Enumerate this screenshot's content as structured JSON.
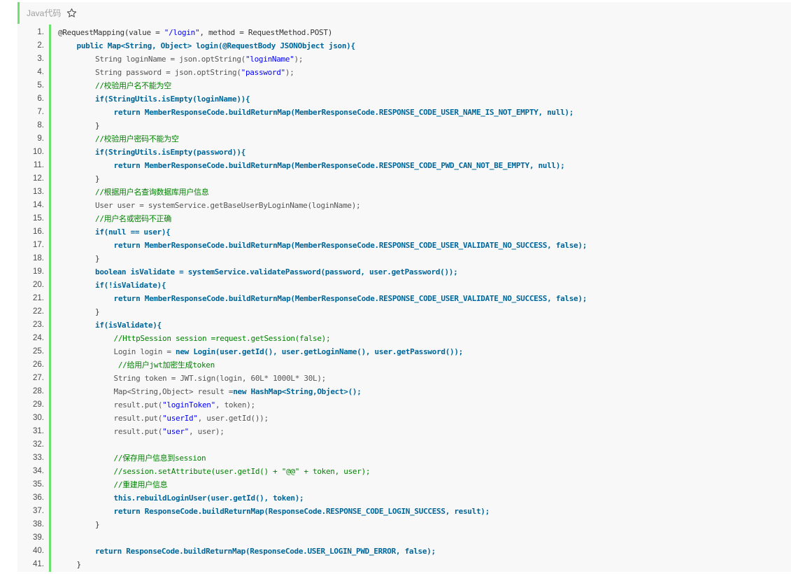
{
  "header": {
    "language_label": "Java代码",
    "favorite_icon": "star-outline-icon"
  },
  "colors": {
    "accent": "#6ce26c",
    "plain": "#333333",
    "keyword": "#006699",
    "string": "#0000ff",
    "comment": "#008200",
    "type": "#555555"
  },
  "lines": [
    {
      "n": "1.",
      "indent": 0,
      "tokens": [
        [
          "p",
          "@RequestMapping(value = "
        ],
        [
          "s",
          "\"/login\""
        ],
        [
          "p",
          ", method = RequestMethod.POST)"
        ]
      ]
    },
    {
      "n": "2.",
      "indent": 1,
      "tokens": [
        [
          "k",
          "public Map<String, Object> login(@RequestBody JSONObject json){"
        ]
      ]
    },
    {
      "n": "3.",
      "indent": 2,
      "tokens": [
        [
          "t",
          "String loginName = json.optString("
        ],
        [
          "s",
          "\"loginName\""
        ],
        [
          "t",
          ");"
        ]
      ]
    },
    {
      "n": "4.",
      "indent": 2,
      "tokens": [
        [
          "t",
          "String password = json.optString("
        ],
        [
          "s",
          "\"password\""
        ],
        [
          "t",
          ");"
        ]
      ]
    },
    {
      "n": "5.",
      "indent": 2,
      "tokens": [
        [
          "c",
          "//校验用户名不能为空"
        ]
      ]
    },
    {
      "n": "6.",
      "indent": 2,
      "tokens": [
        [
          "k",
          "if(StringUtils.isEmpty(loginName)){"
        ]
      ]
    },
    {
      "n": "7.",
      "indent": 3,
      "tokens": [
        [
          "k",
          "return MemberResponseCode.buildReturnMap(MemberResponseCode.RESPONSE_CODE_USER_NAME_IS_NOT_EMPTY, null);"
        ]
      ]
    },
    {
      "n": "8.",
      "indent": 2,
      "tokens": [
        [
          "p",
          "}"
        ]
      ]
    },
    {
      "n": "9.",
      "indent": 2,
      "tokens": [
        [
          "c",
          "//校验用户密码不能为空"
        ]
      ]
    },
    {
      "n": "10.",
      "indent": 2,
      "tokens": [
        [
          "k",
          "if(StringUtils.isEmpty(password)){"
        ]
      ]
    },
    {
      "n": "11.",
      "indent": 3,
      "tokens": [
        [
          "k",
          "return MemberResponseCode.buildReturnMap(MemberResponseCode.RESPONSE_CODE_PWD_CAN_NOT_BE_EMPTY, null);"
        ]
      ]
    },
    {
      "n": "12.",
      "indent": 2,
      "tokens": [
        [
          "p",
          "}"
        ]
      ]
    },
    {
      "n": "13.",
      "indent": 2,
      "tokens": [
        [
          "c",
          "//根据用户名查询数据库用户信息"
        ]
      ]
    },
    {
      "n": "14.",
      "indent": 2,
      "tokens": [
        [
          "t",
          "User user = systemService.getBaseUserByLoginName(loginName);"
        ]
      ]
    },
    {
      "n": "15.",
      "indent": 2,
      "tokens": [
        [
          "c",
          "//用户名或密码不正确"
        ]
      ]
    },
    {
      "n": "16.",
      "indent": 2,
      "tokens": [
        [
          "k",
          "if(null == user){"
        ]
      ]
    },
    {
      "n": "17.",
      "indent": 3,
      "tokens": [
        [
          "k",
          "return MemberResponseCode.buildReturnMap(MemberResponseCode.RESPONSE_CODE_USER_VALIDATE_NO_SUCCESS, false);"
        ]
      ]
    },
    {
      "n": "18.",
      "indent": 2,
      "tokens": [
        [
          "p",
          "}"
        ]
      ]
    },
    {
      "n": "19.",
      "indent": 2,
      "tokens": [
        [
          "k",
          "boolean isValidate = systemService.validatePassword(password, user.getPassword());"
        ]
      ]
    },
    {
      "n": "20.",
      "indent": 2,
      "tokens": [
        [
          "k",
          "if(!isValidate){"
        ]
      ]
    },
    {
      "n": "21.",
      "indent": 3,
      "tokens": [
        [
          "k",
          "return MemberResponseCode.buildReturnMap(MemberResponseCode.RESPONSE_CODE_USER_VALIDATE_NO_SUCCESS, false);"
        ]
      ]
    },
    {
      "n": "22.",
      "indent": 2,
      "tokens": [
        [
          "p",
          "}"
        ]
      ]
    },
    {
      "n": "23.",
      "indent": 2,
      "tokens": [
        [
          "k",
          "if(isValidate){"
        ]
      ]
    },
    {
      "n": "24.",
      "indent": 3,
      "tokens": [
        [
          "c",
          "//HttpSession session =request.getSession(false);"
        ]
      ]
    },
    {
      "n": "25.",
      "indent": 3,
      "tokens": [
        [
          "t",
          "Login login = "
        ],
        [
          "k",
          "new Login(user.getId(), user.getLoginName(), user.getPassword());"
        ]
      ]
    },
    {
      "n": "26.",
      "indent": 3,
      "tokens": [
        [
          "c",
          " //给用户jwt加密生成token"
        ]
      ]
    },
    {
      "n": "27.",
      "indent": 3,
      "tokens": [
        [
          "t",
          "String token = JWT.sign(login, 60L* 1000L* 30L);"
        ]
      ]
    },
    {
      "n": "28.",
      "indent": 3,
      "tokens": [
        [
          "t",
          "Map<String,Object> result ="
        ],
        [
          "k",
          "new HashMap<String,Object>();"
        ]
      ]
    },
    {
      "n": "29.",
      "indent": 3,
      "tokens": [
        [
          "t",
          "result.put("
        ],
        [
          "s",
          "\"loginToken\""
        ],
        [
          "t",
          ", token);"
        ]
      ]
    },
    {
      "n": "30.",
      "indent": 3,
      "tokens": [
        [
          "t",
          "result.put("
        ],
        [
          "s",
          "\"userId\""
        ],
        [
          "t",
          ", user.getId());"
        ]
      ]
    },
    {
      "n": "31.",
      "indent": 3,
      "tokens": [
        [
          "t",
          "result.put("
        ],
        [
          "s",
          "\"user\""
        ],
        [
          "t",
          ", user);"
        ]
      ]
    },
    {
      "n": "32.",
      "indent": 3,
      "tokens": []
    },
    {
      "n": "33.",
      "indent": 3,
      "tokens": [
        [
          "c",
          "//保存用户信息到session"
        ]
      ]
    },
    {
      "n": "34.",
      "indent": 3,
      "tokens": [
        [
          "c",
          "//session.setAttribute(user.getId() + \"@@\" + token, user);"
        ]
      ]
    },
    {
      "n": "35.",
      "indent": 3,
      "tokens": [
        [
          "c",
          "//重建用户信息"
        ]
      ]
    },
    {
      "n": "36.",
      "indent": 3,
      "tokens": [
        [
          "k",
          "this.rebuildLoginUser(user.getId(), token);"
        ]
      ]
    },
    {
      "n": "37.",
      "indent": 3,
      "tokens": [
        [
          "k",
          "return ResponseCode.buildReturnMap(ResponseCode.RESPONSE_CODE_LOGIN_SUCCESS, result);"
        ]
      ]
    },
    {
      "n": "38.",
      "indent": 2,
      "tokens": [
        [
          "p",
          "}"
        ]
      ]
    },
    {
      "n": "39.",
      "indent": 2,
      "tokens": []
    },
    {
      "n": "40.",
      "indent": 2,
      "tokens": [
        [
          "k",
          "return ResponseCode.buildReturnMap(ResponseCode.USER_LOGIN_PWD_ERROR, false);"
        ]
      ]
    },
    {
      "n": "41.",
      "indent": 1,
      "tokens": [
        [
          "p",
          "}"
        ]
      ]
    }
  ]
}
